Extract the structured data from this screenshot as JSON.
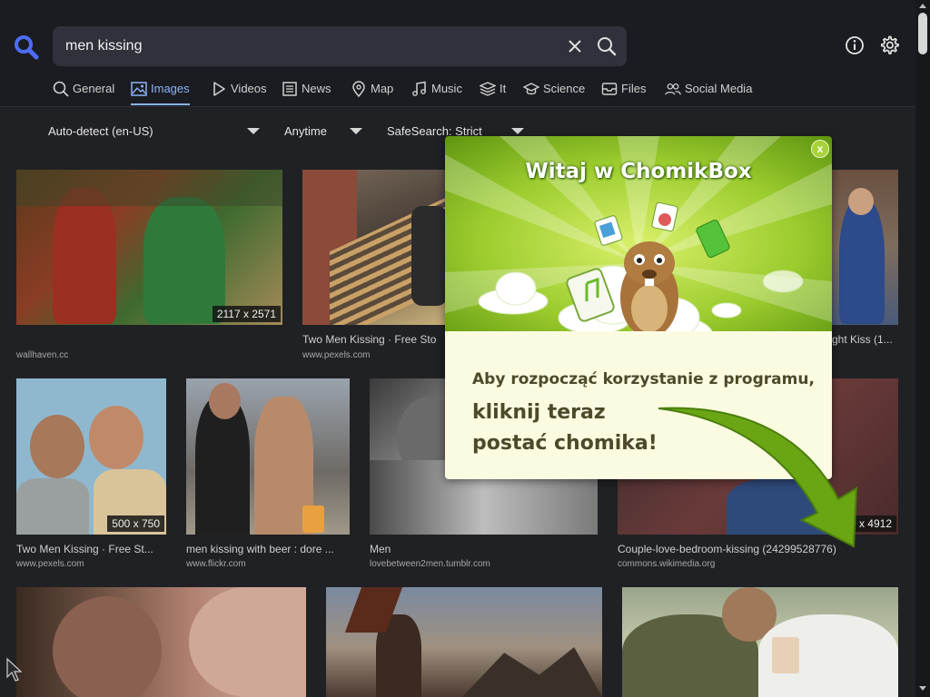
{
  "search": {
    "query": "men kissing"
  },
  "tabs": [
    {
      "label": "General",
      "icon": "search-icon"
    },
    {
      "label": "Images",
      "icon": "image-icon",
      "active": true
    },
    {
      "label": "Videos",
      "icon": "play-icon"
    },
    {
      "label": "News",
      "icon": "newspaper-icon"
    },
    {
      "label": "Map",
      "icon": "map-pin-icon"
    },
    {
      "label": "Music",
      "icon": "music-icon"
    },
    {
      "label": "It",
      "icon": "layers-icon"
    },
    {
      "label": "Science",
      "icon": "graduation-cap-icon"
    },
    {
      "label": "Files",
      "icon": "inbox-icon"
    },
    {
      "label": "Social Media",
      "icon": "users-icon"
    }
  ],
  "filters": {
    "language": "Auto-detect (en-US)",
    "time": "Anytime",
    "safesearch": "SafeSearch: Strict"
  },
  "results": [
    {
      "title": "",
      "source": "wallhaven.cc",
      "dims": "2117 x 2571"
    },
    {
      "title": "Two Men Kissing · Free Sto",
      "source": "www.pexels.com",
      "dims": ""
    },
    {
      "title": "ght Kiss (1...",
      "source": "",
      "dims": ""
    },
    {
      "title": "Two Men Kissing · Free St...",
      "source": "www.pexels.com",
      "dims": "500 x 750"
    },
    {
      "title": "men kissing with beer : dore ...",
      "source": "www.flickr.com",
      "dims": ""
    },
    {
      "title": "Men",
      "source": "lovebetween2men.tumblr.com",
      "dims": ""
    },
    {
      "title": "Couple-love-bedroom-kissing (24299528776)",
      "source": "commons.wikimedia.org",
      "dims": "50 x 4912"
    },
    {
      "title": "",
      "source": "",
      "dims": ""
    },
    {
      "title": "",
      "source": "",
      "dims": ""
    },
    {
      "title": "",
      "source": "",
      "dims": ""
    }
  ],
  "popup": {
    "title": "Witaj w ChomikBox",
    "close": "x",
    "line1": "Aby rozpocząć korzystanie z programu,",
    "line2": "kliknij teraz",
    "line3": "postać chomika!"
  },
  "colors": {
    "accent": "#8ab4f8",
    "logo": "#4d6cf5",
    "popup_green": "#7db51b",
    "popup_cream": "#fbfbe2",
    "arrow_green": "#6aa514"
  }
}
